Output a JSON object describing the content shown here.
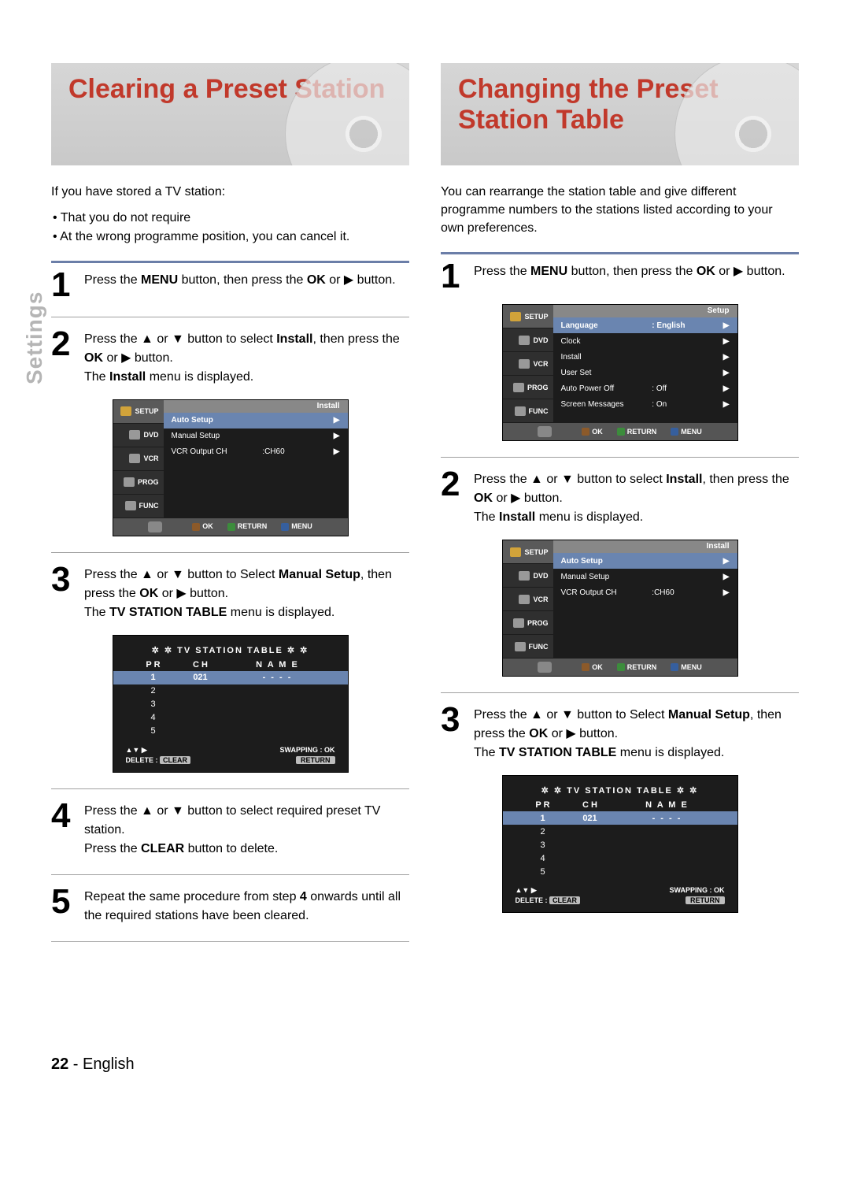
{
  "sidelabel": "Settings",
  "left": {
    "title": "Clearing a Preset Station",
    "intro": "If you have stored a TV station:",
    "bullets": [
      "That you do not require",
      "At the wrong programme position, you can cancel it."
    ],
    "step1": {
      "a": "Press the ",
      "b": "MENU",
      "c": " button, then press the ",
      "d": "OK",
      "e": " or ▶ button."
    },
    "step2": {
      "a": "Press the ▲ or ▼ button to select ",
      "b": "Install",
      "c": ", then press the ",
      "d": "OK",
      "e": " or ▶ button.",
      "f": "The ",
      "g": "Install",
      "h": " menu is displayed."
    },
    "step3": {
      "a": "Press the ▲ or ▼ button to Select ",
      "b": "Manual Setup",
      "c": ", then press the ",
      "d": "OK",
      "e": " or ▶ button.",
      "f": "The ",
      "g": "TV STATION TABLE",
      "h": " menu is displayed."
    },
    "step4": {
      "a": "Press the ▲ or ▼ button to select required preset TV station.",
      "b": "Press the ",
      "c": "CLEAR",
      "d": " button to delete."
    },
    "step5": {
      "a": "Repeat the same procedure from step ",
      "b": "4",
      "c": " onwards until all the required stations have been cleared."
    }
  },
  "right": {
    "title": "Changing the Preset Station Table",
    "intro": "You can rearrange the station table and give different programme numbers to the stations listed according to your own preferences.",
    "step1": {
      "a": "Press the ",
      "b": "MENU",
      "c": " button, then press the ",
      "d": "OK",
      "e": " or ▶ button."
    },
    "step2": {
      "a": "Press the ▲ or ▼ button to select ",
      "b": "Install",
      "c": ", then press the ",
      "d": "OK",
      "e": " or ▶ button.",
      "f": "The ",
      "g": "Install",
      "h": " menu is displayed."
    },
    "step3": {
      "a": "Press the ▲ or ▼ button to Select ",
      "b": "Manual Setup",
      "c": ", then press the ",
      "d": "OK",
      "e": " or ▶ button.",
      "f": "The ",
      "g": "TV STATION TABLE",
      "h": " menu is displayed."
    }
  },
  "osd": {
    "tabs": [
      "SETUP",
      "DVD",
      "VCR",
      "PROG",
      "FUNC"
    ],
    "setup": {
      "header": "Setup",
      "rows": [
        {
          "label": "Language",
          "value": ": English",
          "sel": true,
          "arrow": "▶"
        },
        {
          "label": "Clock",
          "value": "",
          "arrow": "▶"
        },
        {
          "label": "Install",
          "value": "",
          "arrow": "▶"
        },
        {
          "label": "User Set",
          "value": "",
          "arrow": "▶"
        },
        {
          "label": "Auto Power Off",
          "value": ": Off",
          "arrow": "▶"
        },
        {
          "label": "Screen Messages",
          "value": ": On",
          "arrow": "▶"
        }
      ]
    },
    "install": {
      "header": "Install",
      "rows": [
        {
          "label": "Auto Setup",
          "value": "",
          "sel": true,
          "arrow": "▶"
        },
        {
          "label": "Manual Setup",
          "value": "",
          "arrow": "▶"
        },
        {
          "label": "VCR Output CH",
          "value": ":CH60",
          "arrow": "▶"
        }
      ]
    },
    "footer": {
      "ok": "OK",
      "return": "RETURN",
      "menu": "MENU"
    }
  },
  "tvtable": {
    "title": "✲ ✲   TV  STATION  TABLE   ✲ ✲",
    "cols": [
      "P R",
      "C H",
      "N A M E"
    ],
    "rows": [
      {
        "pr": "1",
        "ch": "021",
        "name": "- - - -",
        "sel": true
      },
      {
        "pr": "2",
        "ch": "",
        "name": ""
      },
      {
        "pr": "3",
        "ch": "",
        "name": ""
      },
      {
        "pr": "4",
        "ch": "",
        "name": ""
      },
      {
        "pr": "5",
        "ch": "",
        "name": ""
      }
    ],
    "f1l": "▲▼  ▶",
    "f1r": "SWAPPING : OK",
    "f2l": "DELETE :",
    "f2lb": "CLEAR",
    "f2r": "RETURN"
  },
  "footer": {
    "page": "22",
    "sep": " - ",
    "lang": "English"
  }
}
